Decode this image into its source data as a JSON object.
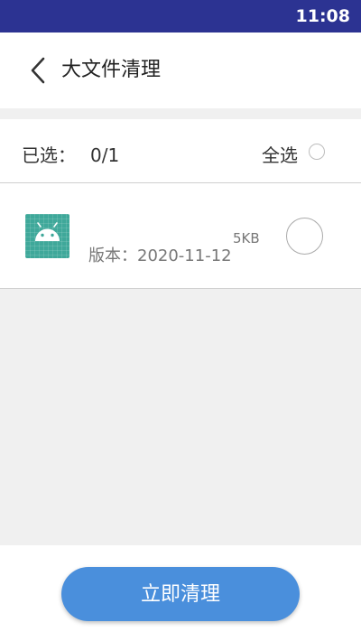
{
  "status_bar": {
    "time": "11:08"
  },
  "header": {
    "title": "大文件清理",
    "back_icon": "chevron-left-icon"
  },
  "selection": {
    "label": "已选：",
    "count": "0/1",
    "select_all_label": "全选",
    "select_all_checked": false
  },
  "files": [
    {
      "icon": "android-app-icon",
      "version": "版本：2020-11-12",
      "size": "5KB",
      "checked": false
    }
  ],
  "actions": {
    "clean_label": "立即清理"
  },
  "colors": {
    "status_bar": "#2c3392",
    "button": "#4a8fdc",
    "app_icon": "#3fa89a",
    "background": "#f0f0f0"
  }
}
